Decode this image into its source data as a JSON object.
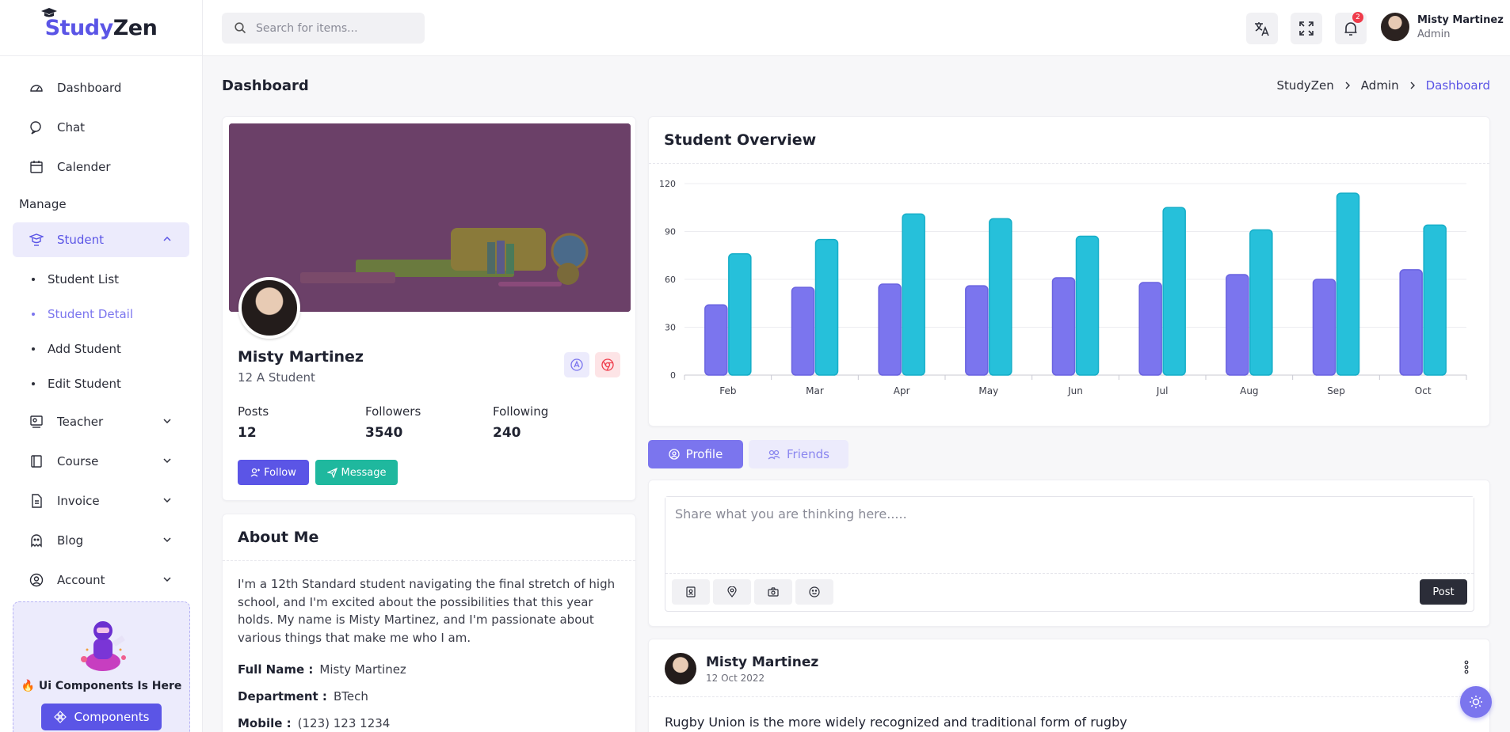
{
  "app": {
    "logo_a": "Study",
    "logo_b": "Zen"
  },
  "sidebar": {
    "items": [
      {
        "label": "Dashboard",
        "icon": "dashboard-icon"
      },
      {
        "label": "Chat",
        "icon": "chat-icon"
      },
      {
        "label": "Calender",
        "icon": "calendar-icon"
      }
    ],
    "section_manage": "Manage",
    "student": {
      "label": "Student",
      "icon": "student-icon"
    },
    "student_sub": [
      "Student List",
      "Student Detail",
      "Add Student",
      "Edit Student"
    ],
    "groups": [
      {
        "label": "Teacher",
        "icon": "teacher-icon"
      },
      {
        "label": "Course",
        "icon": "book-icon"
      },
      {
        "label": "Invoice",
        "icon": "invoice-icon"
      },
      {
        "label": "Blog",
        "icon": "blog-icon"
      },
      {
        "label": "Account",
        "icon": "account-icon"
      }
    ],
    "promo_title": "🔥 Ui Components Is Here",
    "promo_button": "Components"
  },
  "topbar": {
    "search_placeholder": "Search for items...",
    "notification_count": "2",
    "user_name": "Misty Martinez",
    "user_role": "Admin"
  },
  "page": {
    "title": "Dashboard",
    "breadcrumb": [
      "StudyZen",
      "Admin",
      "Dashboard"
    ]
  },
  "profile": {
    "name": "Misty Martinez",
    "class": "12 A Student",
    "stats": [
      {
        "label": "Posts",
        "value": "12"
      },
      {
        "label": "Followers",
        "value": "3540"
      },
      {
        "label": "Following",
        "value": "240"
      }
    ],
    "follow_label": "Follow",
    "message_label": "Message"
  },
  "about": {
    "title": "About Me",
    "text": "I'm a 12th Standard student navigating the final stretch of high school, and I'm excited about the possibilities that this year holds. My name is Misty Martinez, and I'm passionate about various things that make me who I am.",
    "rows": [
      {
        "label": "Full Name :",
        "value": "Misty Martinez"
      },
      {
        "label": "Department :",
        "value": "BTech"
      },
      {
        "label": "Mobile :",
        "value": "(123) 123 1234"
      }
    ]
  },
  "overview": {
    "title": "Student Overview"
  },
  "tabs": {
    "profile": "Profile",
    "friends": "Friends"
  },
  "composer": {
    "placeholder": "Share what you are thinking here.....",
    "post_label": "Post"
  },
  "feed": {
    "name": "Misty Martinez",
    "date": "12 Oct 2022",
    "text": "Rugby Union is the more widely recognized and traditional form of rugby"
  },
  "colors": {
    "accent": "#5b55e6",
    "teal": "#1fb89e",
    "series_a": "#7b75ee",
    "series_b": "#26c0da"
  },
  "chart_data": {
    "type": "bar",
    "categories": [
      "Feb",
      "Mar",
      "Apr",
      "May",
      "Jun",
      "Jul",
      "Aug",
      "Sep",
      "Oct"
    ],
    "series": [
      {
        "values": [
          44,
          55,
          57,
          56,
          61,
          58,
          63,
          60,
          66
        ]
      },
      {
        "values": [
          76,
          85,
          101,
          98,
          87,
          105,
          91,
          114,
          94
        ]
      }
    ],
    "yticks": [
      0,
      30,
      60,
      90,
      120
    ],
    "ylim": [
      0,
      120
    ],
    "grid": true
  }
}
